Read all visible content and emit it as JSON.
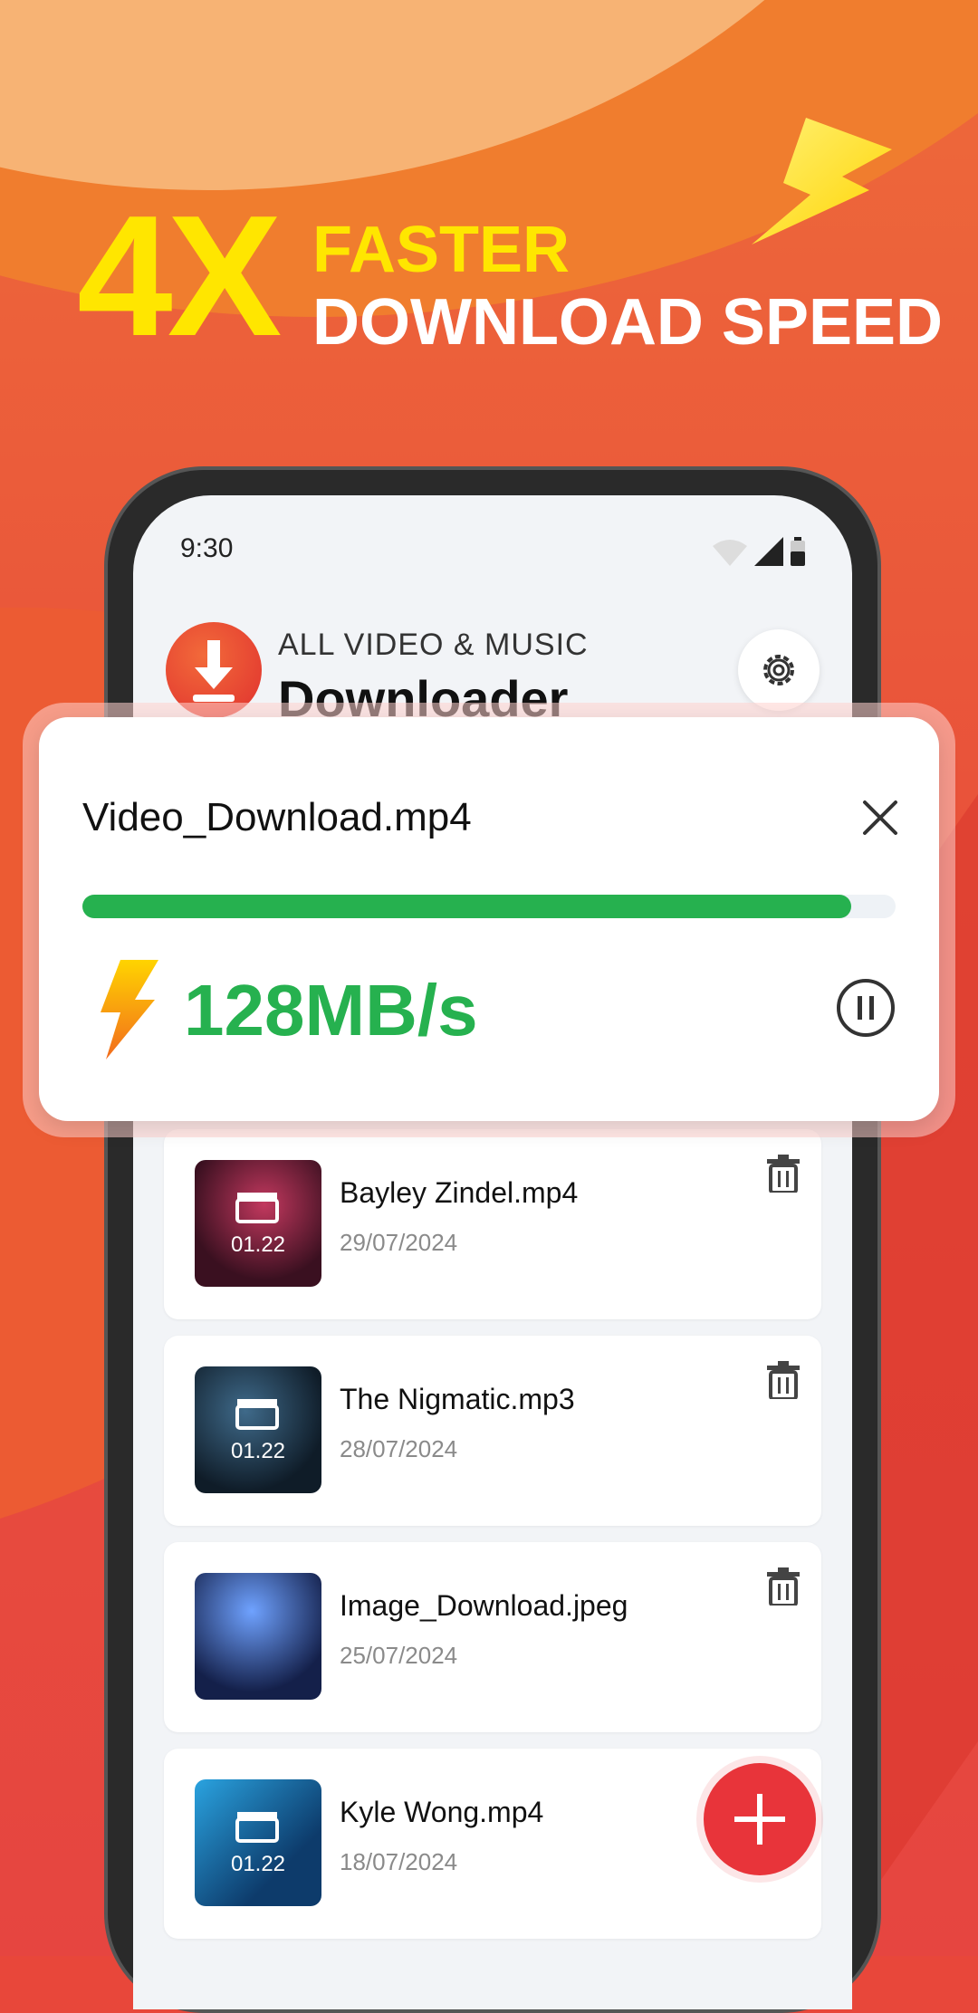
{
  "promo": {
    "big": "4X",
    "line1": "FASTER",
    "line2": "DOWNLOAD SPEED"
  },
  "status": {
    "time": "9:30"
  },
  "app": {
    "brand_top": "ALL VIDEO & MUSIC",
    "brand_main": "Downloader",
    "settings_icon": "gear-icon"
  },
  "download": {
    "filename": "Video_Download.mp4",
    "progress": 0.945,
    "speed": "128MB/s",
    "progress_color": "#26b14f"
  },
  "files": [
    {
      "name": "Bayley Zindel.mp4",
      "date": "29/07/2024",
      "duration": "01.22",
      "has_clap": true
    },
    {
      "name": "The Nigmatic.mp3",
      "date": "28/07/2024",
      "duration": "01.22",
      "has_clap": true
    },
    {
      "name": "Image_Download.jpeg",
      "date": "25/07/2024",
      "duration": "",
      "has_clap": false
    },
    {
      "name": "Kyle Wong.mp4",
      "date": "18/07/2024",
      "duration": "01.22",
      "has_clap": true
    }
  ],
  "colors": {
    "accent": "#e8343a",
    "yellow": "#ffe600",
    "green": "#26b14f"
  }
}
